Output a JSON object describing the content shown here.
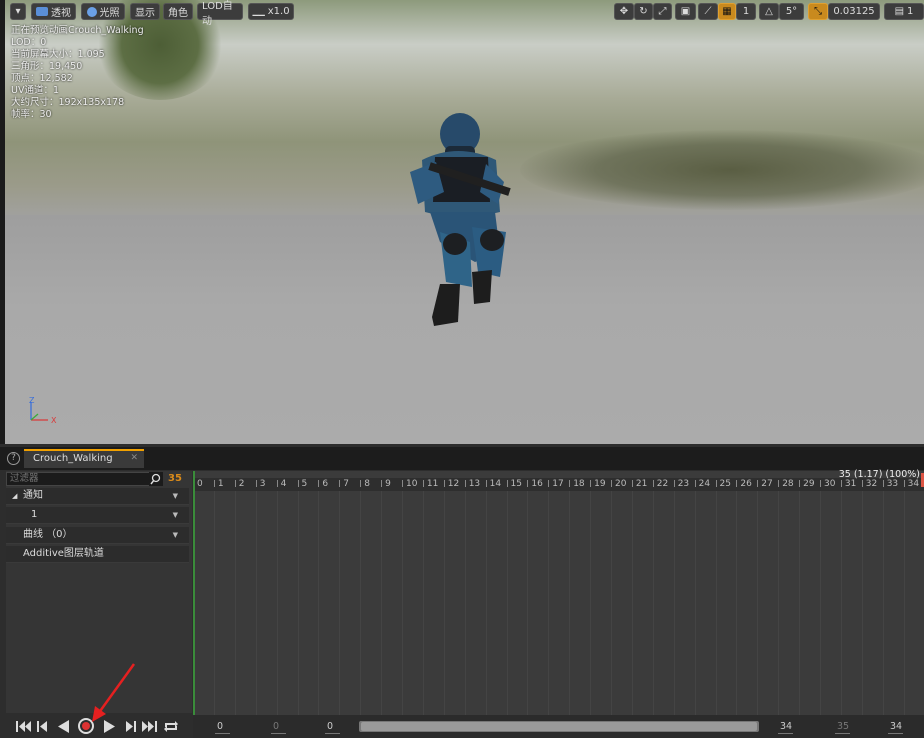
{
  "viewport": {
    "toolbar": {
      "perspective": "透视",
      "lit": "光照",
      "show": "显示",
      "character": "角色",
      "lod": "LOD自动",
      "speed": "x1.0",
      "grid_step": "1",
      "angle": "5°",
      "scale_value": "0.03125",
      "camera_speed": "1"
    },
    "stats": [
      "正在预览动画Crouch_Walking",
      "LOD：0",
      "当前屏幕大小：1.095",
      "三角形：19,450",
      "顶点：12,582",
      "UV通道：1",
      "大约尺寸：192x135x178",
      "帧率：30"
    ],
    "axis": {
      "z": "Z",
      "x": "X"
    }
  },
  "editor": {
    "tab_label": "Crouch_Walking",
    "filter_placeholder": "过滤器",
    "current_frame": "35",
    "tracks": {
      "notifies": "通知",
      "notify_track": "1",
      "curves": "曲线 （0）",
      "additive": "Additive图层轨道"
    },
    "ruler": [
      "0",
      "1",
      "2",
      "3",
      "4",
      "5",
      "6",
      "7",
      "8",
      "9",
      "10",
      "11",
      "12",
      "13",
      "14",
      "15",
      "16",
      "17",
      "18",
      "19",
      "20",
      "21",
      "22",
      "23",
      "24",
      "25",
      "26",
      "27",
      "28",
      "29",
      "30",
      "31",
      "32",
      "33",
      "34"
    ],
    "playhead_label": "35 (1.17) (100%)",
    "scroll_numbers": {
      "a": "0",
      "b": "0",
      "c": "0",
      "d": "34",
      "e": "35",
      "f": "34"
    }
  },
  "colors": {
    "accent": "#f0a000",
    "record": "#dd3333",
    "arrow": "#e52020"
  }
}
